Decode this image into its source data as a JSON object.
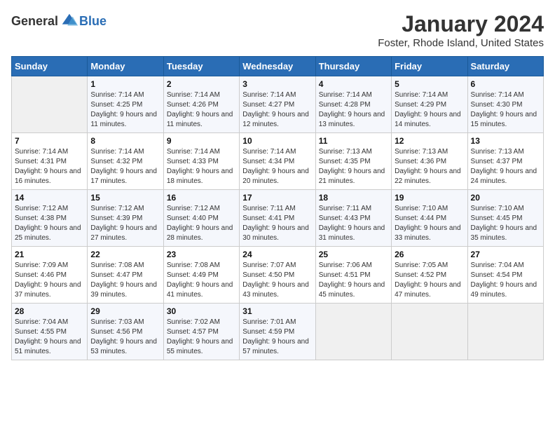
{
  "logo": {
    "general": "General",
    "blue": "Blue"
  },
  "title": "January 2024",
  "subtitle": "Foster, Rhode Island, United States",
  "weekdays": [
    "Sunday",
    "Monday",
    "Tuesday",
    "Wednesday",
    "Thursday",
    "Friday",
    "Saturday"
  ],
  "weeks": [
    [
      {
        "day": "",
        "sunrise": "",
        "sunset": "",
        "daylight": ""
      },
      {
        "day": "1",
        "sunrise": "Sunrise: 7:14 AM",
        "sunset": "Sunset: 4:25 PM",
        "daylight": "Daylight: 9 hours and 11 minutes."
      },
      {
        "day": "2",
        "sunrise": "Sunrise: 7:14 AM",
        "sunset": "Sunset: 4:26 PM",
        "daylight": "Daylight: 9 hours and 11 minutes."
      },
      {
        "day": "3",
        "sunrise": "Sunrise: 7:14 AM",
        "sunset": "Sunset: 4:27 PM",
        "daylight": "Daylight: 9 hours and 12 minutes."
      },
      {
        "day": "4",
        "sunrise": "Sunrise: 7:14 AM",
        "sunset": "Sunset: 4:28 PM",
        "daylight": "Daylight: 9 hours and 13 minutes."
      },
      {
        "day": "5",
        "sunrise": "Sunrise: 7:14 AM",
        "sunset": "Sunset: 4:29 PM",
        "daylight": "Daylight: 9 hours and 14 minutes."
      },
      {
        "day": "6",
        "sunrise": "Sunrise: 7:14 AM",
        "sunset": "Sunset: 4:30 PM",
        "daylight": "Daylight: 9 hours and 15 minutes."
      }
    ],
    [
      {
        "day": "7",
        "sunrise": "Sunrise: 7:14 AM",
        "sunset": "Sunset: 4:31 PM",
        "daylight": "Daylight: 9 hours and 16 minutes."
      },
      {
        "day": "8",
        "sunrise": "Sunrise: 7:14 AM",
        "sunset": "Sunset: 4:32 PM",
        "daylight": "Daylight: 9 hours and 17 minutes."
      },
      {
        "day": "9",
        "sunrise": "Sunrise: 7:14 AM",
        "sunset": "Sunset: 4:33 PM",
        "daylight": "Daylight: 9 hours and 18 minutes."
      },
      {
        "day": "10",
        "sunrise": "Sunrise: 7:14 AM",
        "sunset": "Sunset: 4:34 PM",
        "daylight": "Daylight: 9 hours and 20 minutes."
      },
      {
        "day": "11",
        "sunrise": "Sunrise: 7:13 AM",
        "sunset": "Sunset: 4:35 PM",
        "daylight": "Daylight: 9 hours and 21 minutes."
      },
      {
        "day": "12",
        "sunrise": "Sunrise: 7:13 AM",
        "sunset": "Sunset: 4:36 PM",
        "daylight": "Daylight: 9 hours and 22 minutes."
      },
      {
        "day": "13",
        "sunrise": "Sunrise: 7:13 AM",
        "sunset": "Sunset: 4:37 PM",
        "daylight": "Daylight: 9 hours and 24 minutes."
      }
    ],
    [
      {
        "day": "14",
        "sunrise": "Sunrise: 7:12 AM",
        "sunset": "Sunset: 4:38 PM",
        "daylight": "Daylight: 9 hours and 25 minutes."
      },
      {
        "day": "15",
        "sunrise": "Sunrise: 7:12 AM",
        "sunset": "Sunset: 4:39 PM",
        "daylight": "Daylight: 9 hours and 27 minutes."
      },
      {
        "day": "16",
        "sunrise": "Sunrise: 7:12 AM",
        "sunset": "Sunset: 4:40 PM",
        "daylight": "Daylight: 9 hours and 28 minutes."
      },
      {
        "day": "17",
        "sunrise": "Sunrise: 7:11 AM",
        "sunset": "Sunset: 4:41 PM",
        "daylight": "Daylight: 9 hours and 30 minutes."
      },
      {
        "day": "18",
        "sunrise": "Sunrise: 7:11 AM",
        "sunset": "Sunset: 4:43 PM",
        "daylight": "Daylight: 9 hours and 31 minutes."
      },
      {
        "day": "19",
        "sunrise": "Sunrise: 7:10 AM",
        "sunset": "Sunset: 4:44 PM",
        "daylight": "Daylight: 9 hours and 33 minutes."
      },
      {
        "day": "20",
        "sunrise": "Sunrise: 7:10 AM",
        "sunset": "Sunset: 4:45 PM",
        "daylight": "Daylight: 9 hours and 35 minutes."
      }
    ],
    [
      {
        "day": "21",
        "sunrise": "Sunrise: 7:09 AM",
        "sunset": "Sunset: 4:46 PM",
        "daylight": "Daylight: 9 hours and 37 minutes."
      },
      {
        "day": "22",
        "sunrise": "Sunrise: 7:08 AM",
        "sunset": "Sunset: 4:47 PM",
        "daylight": "Daylight: 9 hours and 39 minutes."
      },
      {
        "day": "23",
        "sunrise": "Sunrise: 7:08 AM",
        "sunset": "Sunset: 4:49 PM",
        "daylight": "Daylight: 9 hours and 41 minutes."
      },
      {
        "day": "24",
        "sunrise": "Sunrise: 7:07 AM",
        "sunset": "Sunset: 4:50 PM",
        "daylight": "Daylight: 9 hours and 43 minutes."
      },
      {
        "day": "25",
        "sunrise": "Sunrise: 7:06 AM",
        "sunset": "Sunset: 4:51 PM",
        "daylight": "Daylight: 9 hours and 45 minutes."
      },
      {
        "day": "26",
        "sunrise": "Sunrise: 7:05 AM",
        "sunset": "Sunset: 4:52 PM",
        "daylight": "Daylight: 9 hours and 47 minutes."
      },
      {
        "day": "27",
        "sunrise": "Sunrise: 7:04 AM",
        "sunset": "Sunset: 4:54 PM",
        "daylight": "Daylight: 9 hours and 49 minutes."
      }
    ],
    [
      {
        "day": "28",
        "sunrise": "Sunrise: 7:04 AM",
        "sunset": "Sunset: 4:55 PM",
        "daylight": "Daylight: 9 hours and 51 minutes."
      },
      {
        "day": "29",
        "sunrise": "Sunrise: 7:03 AM",
        "sunset": "Sunset: 4:56 PM",
        "daylight": "Daylight: 9 hours and 53 minutes."
      },
      {
        "day": "30",
        "sunrise": "Sunrise: 7:02 AM",
        "sunset": "Sunset: 4:57 PM",
        "daylight": "Daylight: 9 hours and 55 minutes."
      },
      {
        "day": "31",
        "sunrise": "Sunrise: 7:01 AM",
        "sunset": "Sunset: 4:59 PM",
        "daylight": "Daylight: 9 hours and 57 minutes."
      },
      {
        "day": "",
        "sunrise": "",
        "sunset": "",
        "daylight": ""
      },
      {
        "day": "",
        "sunrise": "",
        "sunset": "",
        "daylight": ""
      },
      {
        "day": "",
        "sunrise": "",
        "sunset": "",
        "daylight": ""
      }
    ]
  ]
}
